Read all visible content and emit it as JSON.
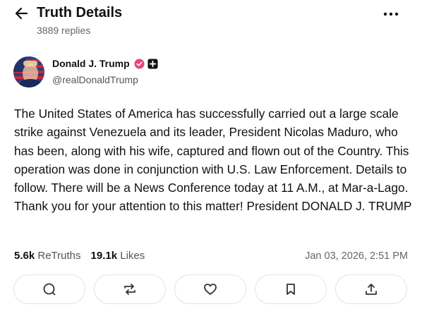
{
  "header": {
    "title": "Truth Details",
    "replies": "3889 replies"
  },
  "author": {
    "name": "Donald J. Trump",
    "handle": "@realDonaldTrump"
  },
  "post": {
    "text": "The United States of America has successfully carried out a large scale strike against Venezuela and its leader, President Nicolas Maduro, who has been, along with his wife, captured and flown out of the Country. This operation was done in conjunction with U.S. Law Enforcement. Details to follow. There will be a News Conference today at 11 A.M., at Mar-a-Lago. Thank you for your attention to this matter! President DONALD J. TRUMP",
    "retruths_count": "5.6k",
    "retruths_label": "ReTruths",
    "likes_count": "19.1k",
    "likes_label": "Likes",
    "timestamp": "Jan 03, 2026, 2:51 PM"
  },
  "icons": {
    "back": "arrow-left-icon",
    "more": "more-horizontal-icon",
    "verified": "verified-badge-icon",
    "plus": "plus-badge-icon",
    "reply": "reply-icon",
    "retruth": "retruth-icon",
    "like": "heart-icon",
    "bookmark": "bookmark-icon",
    "share": "share-icon"
  },
  "colors": {
    "verified": "#e8467c",
    "text": "#111111",
    "muted": "#666666"
  }
}
